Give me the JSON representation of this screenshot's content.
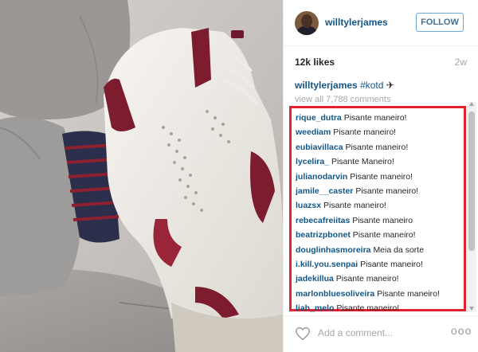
{
  "post": {
    "author": {
      "username": "willtylerjames"
    },
    "follow_label": "FOLLOW",
    "likes": "12k likes",
    "age": "2w",
    "caption": {
      "username": "willtylerjames",
      "hashtag": "#kotd",
      "emoji": "✈"
    },
    "view_all": "view all 7,788 comments",
    "comments": [
      {
        "user": "rique_dutra",
        "text": "Pisante maneiro!"
      },
      {
        "user": "weediam",
        "text": "Pisante maneiro!"
      },
      {
        "user": "eubiavillaca",
        "text": "Pisante maneiro!"
      },
      {
        "user": "lycelira_",
        "text": "Pisante Maneiro!"
      },
      {
        "user": "julianodarvin",
        "text": "Pisante maneiro!"
      },
      {
        "user": "jamile__caster",
        "text": "Pisante maneiro!"
      },
      {
        "user": "luazsx",
        "text": "Pisante maneiro!"
      },
      {
        "user": "rebecafreiitas",
        "text": "Pisante maneiro"
      },
      {
        "user": "beatrizpbonet",
        "text": "Pisante maneiro!"
      },
      {
        "user": "douglinhasmoreira",
        "text": "Meia da sorte"
      },
      {
        "user": "i.kill.you.senpai",
        "text": "Pisante maneiro!"
      },
      {
        "user": "jadekillua",
        "text": "Pisante maneiro!"
      },
      {
        "user": "marlonbluesoliveira",
        "text": "Pisante maneiro!"
      },
      {
        "user": "liah_melo",
        "text": "Pisante maneiro!"
      }
    ],
    "add_comment_placeholder": "Add a comment...",
    "more_label": "ooo"
  },
  "colors": {
    "link": "#125688",
    "follow_border": "#6aa7d4",
    "highlight": "#e0232e",
    "muted": "#a5a7aa"
  }
}
